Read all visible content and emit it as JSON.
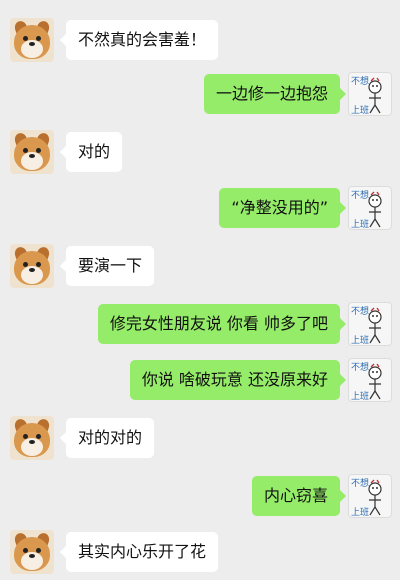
{
  "conversation": {
    "messages": [
      {
        "side": "left",
        "avatar": "shiba-dog-avatar",
        "text": "不然真的会害羞！"
      },
      {
        "side": "right",
        "avatar": "stick-figure-avatar",
        "text": "一边修一边抱怨"
      },
      {
        "side": "left",
        "avatar": "shiba-dog-avatar",
        "text": "对的"
      },
      {
        "side": "right",
        "avatar": "stick-figure-avatar",
        "text": "“净整没用的”"
      },
      {
        "side": "left",
        "avatar": "shiba-dog-avatar",
        "text": "要演一下"
      },
      {
        "side": "right",
        "avatar": "stick-figure-avatar",
        "text": "修完女性朋友说 你看 帅多了吧"
      },
      {
        "side": "right",
        "avatar": "stick-figure-avatar",
        "text": "你说 啥破玩意 还没原来好"
      },
      {
        "side": "left",
        "avatar": "shiba-dog-avatar",
        "text": "对的对的"
      },
      {
        "side": "right",
        "avatar": "stick-figure-avatar",
        "text": "内心窃喜"
      },
      {
        "side": "left",
        "avatar": "shiba-dog-avatar",
        "text": "其实内心乐开了花"
      }
    ],
    "sticker_text": {
      "top": "不想",
      "bottom": "上班"
    }
  },
  "colors": {
    "background": "#ededed",
    "incoming_bubble": "#ffffff",
    "outgoing_bubble": "#95ec69"
  }
}
